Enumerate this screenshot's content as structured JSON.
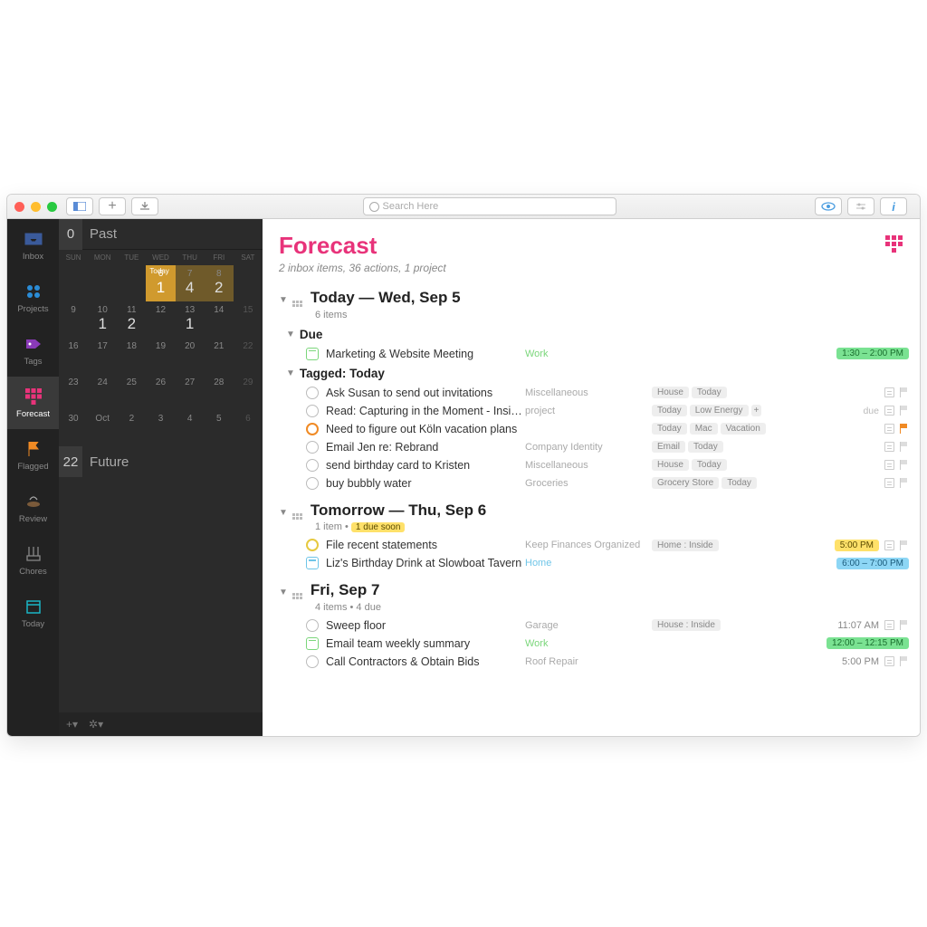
{
  "toolbar": {
    "search_placeholder": "Search Here"
  },
  "sidebar": {
    "items": [
      {
        "label": "Inbox"
      },
      {
        "label": "Projects"
      },
      {
        "label": "Tags"
      },
      {
        "label": "Forecast"
      },
      {
        "label": "Flagged"
      },
      {
        "label": "Review"
      },
      {
        "label": "Chores"
      },
      {
        "label": "Today"
      }
    ]
  },
  "calendar": {
    "past_count": "0",
    "past_label": "Past",
    "dows": [
      "SUN",
      "MON",
      "TUE",
      "WED",
      "THU",
      "FRI",
      "SAT"
    ],
    "future_count": "22",
    "future_label": "Future",
    "today_label": "Today",
    "weeks": [
      [
        {
          "d": ""
        },
        {
          "d": ""
        },
        {
          "d": ""
        },
        {
          "d": "6",
          "n": "",
          "today": true
        },
        {
          "d": "7",
          "n": "4",
          "hl": true
        },
        {
          "d": "8",
          "n": "2",
          "hl": true
        },
        {
          "d": "",
          "muted": true
        }
      ],
      [
        {
          "d": "9",
          "n": ""
        },
        {
          "d": "10",
          "n": "1"
        },
        {
          "d": "11",
          "n": "2"
        },
        {
          "d": "12",
          "n": ""
        },
        {
          "d": "13",
          "n": "1"
        },
        {
          "d": "14",
          "n": ""
        },
        {
          "d": "15",
          "n": "",
          "muted": true
        }
      ],
      [
        {
          "d": "16",
          "n": ""
        },
        {
          "d": "17",
          "n": ""
        },
        {
          "d": "18",
          "n": ""
        },
        {
          "d": "19",
          "n": ""
        },
        {
          "d": "20",
          "n": ""
        },
        {
          "d": "21",
          "n": ""
        },
        {
          "d": "22",
          "n": "",
          "muted": true
        }
      ],
      [
        {
          "d": "23",
          "n": ""
        },
        {
          "d": "24",
          "n": ""
        },
        {
          "d": "25",
          "n": ""
        },
        {
          "d": "26",
          "n": ""
        },
        {
          "d": "27",
          "n": ""
        },
        {
          "d": "28",
          "n": ""
        },
        {
          "d": "29",
          "n": "",
          "muted": true
        }
      ],
      [
        {
          "d": "30",
          "n": ""
        },
        {
          "d": "Oct",
          "n": ""
        },
        {
          "d": "2",
          "n": ""
        },
        {
          "d": "3",
          "n": ""
        },
        {
          "d": "4",
          "n": ""
        },
        {
          "d": "5",
          "n": ""
        },
        {
          "d": "6",
          "n": "",
          "muted": true
        }
      ]
    ]
  },
  "main": {
    "title": "Forecast",
    "subtitle": "2 inbox items, 36 actions, 1 project"
  },
  "sections": [
    {
      "title": "Today — Wed, Sep 5",
      "meta": "6 items",
      "groups": [
        {
          "title": "Due",
          "rows": [
            {
              "icon": "cal",
              "title": "Marketing & Website Meeting",
              "proj": "Work",
              "projClass": "work",
              "tags": [],
              "badge": "1:30 – 2:00 PM",
              "badgeClass": "green"
            }
          ]
        },
        {
          "title": "Tagged: Today",
          "rows": [
            {
              "icon": "circle",
              "title": "Ask Susan to send out invitations",
              "proj": "Miscellaneous",
              "tags": [
                "House",
                "Today"
              ],
              "note": true,
              "flag": true
            },
            {
              "icon": "circle",
              "title": "Read: Capturing in the Moment - Insid…",
              "proj": "project",
              "tags": [
                "Today",
                "Low Energy"
              ],
              "moreTags": "+",
              "dueLabel": "due",
              "note": true,
              "flag": true
            },
            {
              "icon": "circle-orange",
              "title": "Need to figure out Köln vacation plans",
              "tags": [
                "Today",
                "Mac",
                "Vacation"
              ],
              "note": true,
              "flag": "orange"
            },
            {
              "icon": "circle",
              "title": "Email Jen re: Rebrand",
              "proj": "Company Identity",
              "tags": [
                "Email",
                "Today"
              ],
              "note": true,
              "flag": true
            },
            {
              "icon": "circle",
              "title": "send birthday card to Kristen",
              "proj": "Miscellaneous",
              "tags": [
                "House",
                "Today"
              ],
              "note": true,
              "flag": true
            },
            {
              "icon": "circle",
              "title": "buy bubbly water",
              "proj": "Groceries",
              "tags": [
                "Grocery Store",
                "Today"
              ],
              "note": true,
              "flag": true
            }
          ]
        }
      ]
    },
    {
      "title": "Tomorrow — Thu, Sep 6",
      "meta": "1 item •",
      "soon": "1 due soon",
      "groups": [
        {
          "rows": [
            {
              "icon": "circle-yellow",
              "title": "File recent statements",
              "proj": "Keep Finances Organized",
              "tags": [
                "Home : Inside"
              ],
              "badge": "5:00 PM",
              "badgeClass": "yellow",
              "note": true,
              "flag": true
            },
            {
              "icon": "cal-blue",
              "title": "Liz's Birthday Drink at Slowboat Tavern",
              "proj": "Home",
              "projClass": "home",
              "tags": [],
              "badge": "6:00 – 7:00 PM",
              "badgeClass": "blue"
            }
          ]
        }
      ]
    },
    {
      "title": "Fri, Sep 7",
      "meta": "4 items • 4 due",
      "groups": [
        {
          "rows": [
            {
              "icon": "circle",
              "title": "Sweep floor",
              "proj": "Garage",
              "tags": [
                "House : Inside"
              ],
              "time": "11:07 AM",
              "note": true,
              "flag": true
            },
            {
              "icon": "cal",
              "title": "Email team weekly summary",
              "proj": "Work",
              "projClass": "work",
              "tags": [],
              "badge": "12:00 – 12:15 PM",
              "badgeClass": "green"
            },
            {
              "icon": "circle",
              "title": "Call Contractors & Obtain Bids",
              "proj": "Roof Repair",
              "tags": [],
              "time": "5:00 PM",
              "note": true,
              "flag": true
            }
          ]
        }
      ]
    }
  ]
}
